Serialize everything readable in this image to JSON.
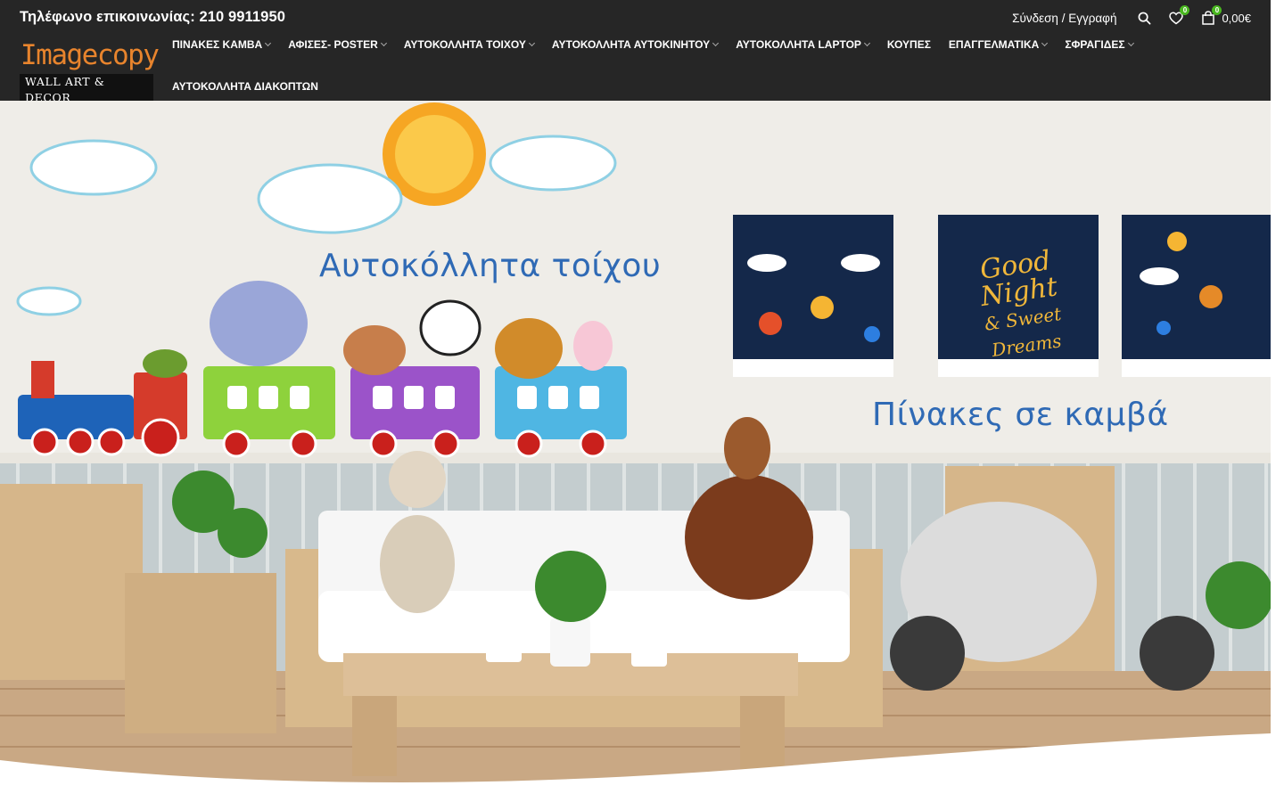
{
  "topbar": {
    "phone": "Τηλέφωνο επικοινωνίας: 210 9911950",
    "login": "Σύνδεση / Εγγραφή",
    "wishlist_count": "0",
    "cart_count": "0",
    "cart_total": "0,00€"
  },
  "logo": {
    "title": "Imagecopy",
    "subtitle": "WALL ART & DECOR"
  },
  "nav": {
    "items": [
      {
        "label": "ΠΙΝΑΚΕΣ ΚΑΜΒΑ",
        "dropdown": true
      },
      {
        "label": "ΑΦΙΣΕΣ- POSTER",
        "dropdown": true
      },
      {
        "label": "ΑΥΤΟΚΟΛΛΗΤΑ ΤΟΙΧΟΥ",
        "dropdown": true
      },
      {
        "label": "ΑΥΤΟΚΟΛΛΗΤΑ ΑΥΤΟΚΙΝΗΤΟΥ",
        "dropdown": true
      },
      {
        "label": "ΑΥΤΟΚΟΛΛΗΤΑ LAPTOP",
        "dropdown": true
      },
      {
        "label": "ΚΟΥΠΕΣ",
        "dropdown": false
      },
      {
        "label": "ΕΠΑΓΓΕΛΜΑΤΙΚΑ",
        "dropdown": true
      },
      {
        "label": "ΣΦΡΑΓΙΔΕΣ",
        "dropdown": true
      },
      {
        "label": "ΑΥΤΟΚΟΛΛΗΤΑ ΔΙΑΚΟΠΤΩΝ",
        "dropdown": false
      }
    ]
  },
  "hero": {
    "wall_stickers_title": "Αυτοκόλλητα τοίχου",
    "canvas_title": "Πίνακες σε καμβά",
    "canvas_print_line1": "Good",
    "canvas_print_line2": "Night",
    "canvas_print_line3": "& Sweet Dreams"
  },
  "colors": {
    "header_bg": "#262626",
    "logo_orange": "#e8842d",
    "badge_green": "#49b71f",
    "hero_text_blue": "#2f6ab5"
  }
}
